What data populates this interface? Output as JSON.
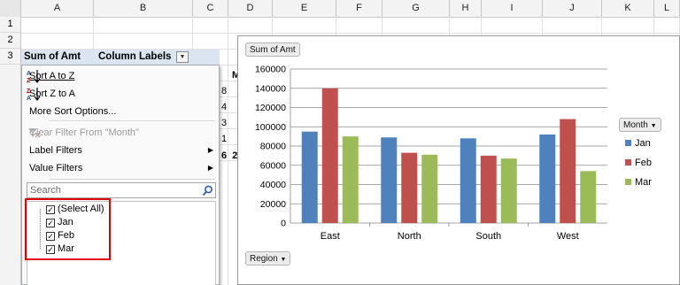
{
  "columns": [
    "A",
    "B",
    "C",
    "D",
    "E",
    "F",
    "G",
    "H",
    "I",
    "J",
    "K",
    "L"
  ],
  "rows": [
    "1",
    "2",
    "3"
  ],
  "pivot": {
    "values_label": "Sum of Amt",
    "column_labels": "Column Labels",
    "peek_chars": [
      "M",
      "8",
      "4",
      "3",
      "1",
      "6  2"
    ]
  },
  "menu": {
    "sort_az": "Sort A to Z",
    "sort_za": "Sort Z to A",
    "more_sort": "More Sort Options...",
    "clear_filter": "Clear Filter From \"Month\"",
    "label_filters": "Label Filters",
    "value_filters": "Value Filters",
    "search_placeholder": "Search",
    "items": [
      "(Select All)",
      "Jan",
      "Feb",
      "Mar"
    ]
  },
  "colors": {
    "jan": "#4f81bd",
    "feb": "#c0504d",
    "mar": "#9bbb59",
    "redbox": "#e00000"
  },
  "chart_data": {
    "type": "bar",
    "field_value": "Sum of Amt",
    "axis_field": "Region",
    "legend_field": "Month",
    "categories": [
      "East",
      "North",
      "South",
      "West"
    ],
    "series": [
      {
        "name": "Jan",
        "values": [
          95000,
          89000,
          88000,
          92000
        ]
      },
      {
        "name": "Feb",
        "values": [
          140000,
          73000,
          70000,
          108000
        ]
      },
      {
        "name": "Mar",
        "values": [
          90000,
          71000,
          67000,
          54000
        ]
      }
    ],
    "ylim": [
      0,
      160000
    ],
    "yticks": [
      "0",
      "20000",
      "40000",
      "60000",
      "80000",
      "100000",
      "120000",
      "140000",
      "160000"
    ],
    "grid": true,
    "legend_position": "right"
  }
}
